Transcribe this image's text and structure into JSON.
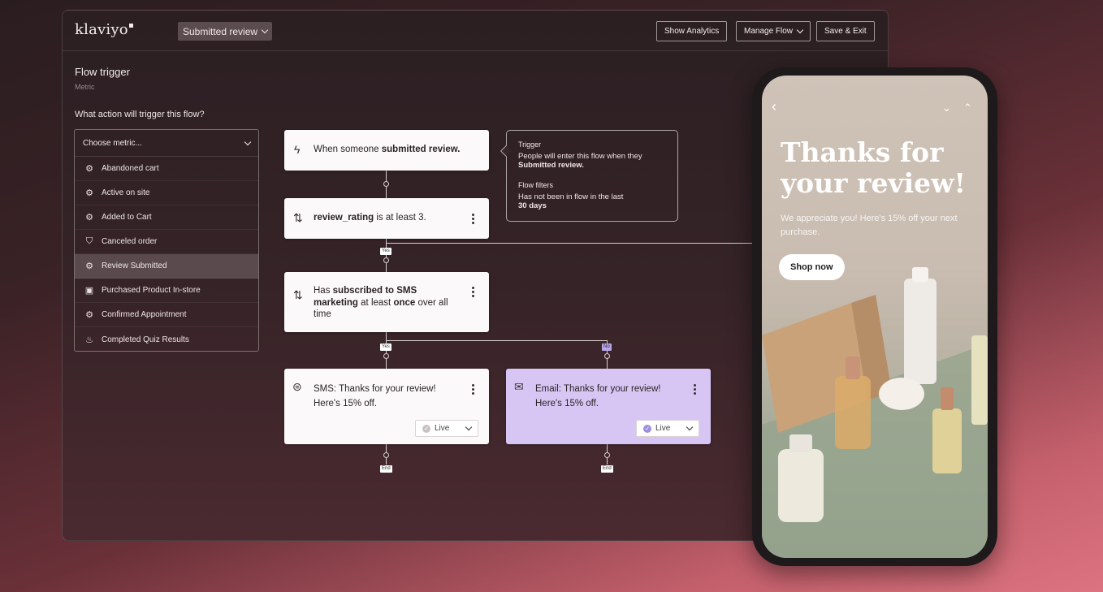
{
  "app": {
    "logo": "klaviyo",
    "flow_name": "Submitted review",
    "buttons": {
      "show_analytics": "Show Analytics",
      "manage_flow": "Manage Flow",
      "save_exit": "Save & Exit"
    }
  },
  "trigger_panel": {
    "title": "Flow trigger",
    "subtitle": "Metric",
    "question": "What action will trigger this flow?",
    "dropdown_placeholder": "Choose metric...",
    "metrics": [
      {
        "label": "Abandoned cart",
        "icon": "gear-icon"
      },
      {
        "label": "Active on site",
        "icon": "gear-icon"
      },
      {
        "label": "Added to Cart",
        "icon": "gear-icon"
      },
      {
        "label": "Canceled order",
        "icon": "shopify-bag-icon"
      },
      {
        "label": "Review Submitted",
        "icon": "gear-icon",
        "selected": true
      },
      {
        "label": "Purchased Product In-store",
        "icon": "square-store-icon"
      },
      {
        "label": "Confirmed Appointment",
        "icon": "gear-icon"
      },
      {
        "label": "Completed Quiz Results",
        "icon": "flame-icon"
      }
    ]
  },
  "flow": {
    "trigger_node": {
      "prefix": "When someone ",
      "bold": "submitted review."
    },
    "split1": {
      "bold": "review_rating",
      "suffix": " is at least 3."
    },
    "split2": {
      "prefix": "Has ",
      "bold1": "subscribed to SMS marketing",
      "middle": " at least ",
      "bold2": "once",
      "suffix": " over all time"
    },
    "sms_node": {
      "text": "SMS: Thanks for your review! Here's 15% off.",
      "status": "Live"
    },
    "email_node": {
      "text": "Email: Thanks for your review! Here's 15% off.",
      "status": "Live"
    },
    "tags": {
      "yes1": "Yes",
      "yes2": "Yes",
      "no": "No",
      "end1": "End",
      "end2": "End"
    },
    "info_card": {
      "trigger_label": "Trigger",
      "trigger_text": "People will enter this flow when they",
      "trigger_bold": "Submitted review.",
      "filters_label": "Flow filters",
      "filters_text": "Has not been in flow in the last",
      "filters_bold": "30 days"
    }
  },
  "phone": {
    "headline": "Thanks for your review!",
    "subtext": "We appreciate you! Here's 15% off your next purchase.",
    "cta": "Shop now"
  },
  "colors": {
    "email_node_bg": "#d7c6f3",
    "live_check": "#9d8fe0",
    "no_tag": "#b7a6e6"
  }
}
